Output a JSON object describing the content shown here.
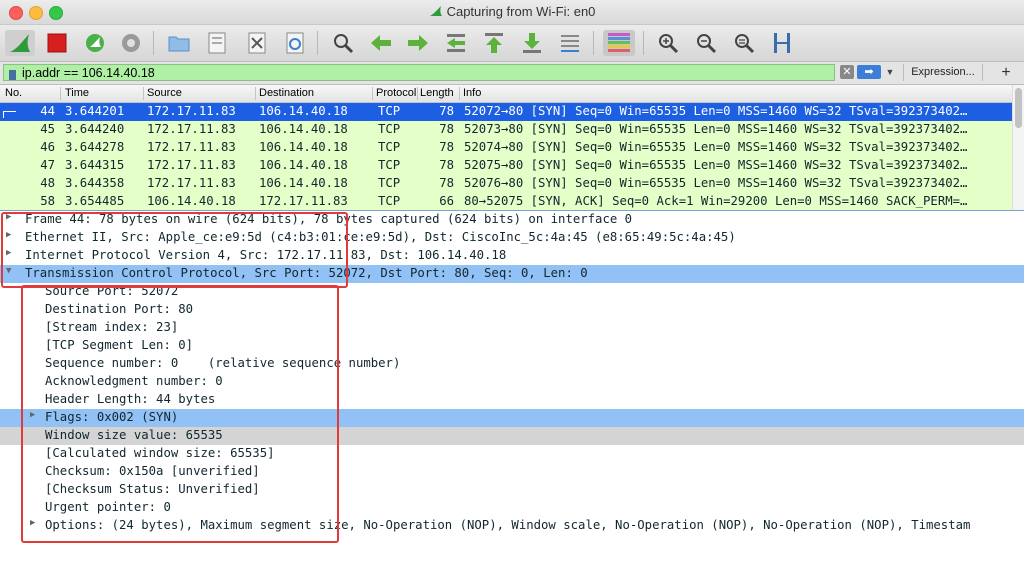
{
  "window": {
    "title": "Capturing from Wi-Fi: en0",
    "accent_green": "#2e9a3a",
    "selected_row_color": "#1c5fe3",
    "packet_row_color": "#e4ffc7",
    "highlight_color": "#92c1f5",
    "annotation_color": "#e03a3a"
  },
  "toolbar": {
    "buttons": [
      "shark-fin-icon",
      "stop-icon",
      "restart-icon",
      "options-gear-icon",
      "open-folder-icon",
      "save-file-icon",
      "close-file-icon",
      "reload-icon",
      "find-icon",
      "go-back-icon",
      "go-forward-icon",
      "go-to-packet-icon",
      "first-packet-icon",
      "last-packet-icon",
      "autoscroll-icon",
      "colorize-icon",
      "zoom-in-icon",
      "zoom-out-icon",
      "zoom-reset-icon",
      "resize-columns-icon"
    ]
  },
  "filter": {
    "value": "ip.addr == 106.14.40.18",
    "expression_label": "Expression...",
    "plus_label": "+"
  },
  "packet_list": {
    "columns": [
      "No.",
      "Time",
      "Source",
      "Destination",
      "Protocol",
      "Length",
      "Info"
    ],
    "rows": [
      {
        "no": "44",
        "time": "3.644201",
        "src": "172.17.11.83",
        "dst": "106.14.40.18",
        "proto": "TCP",
        "len": "78",
        "info": "52072→80 [SYN] Seq=0 Win=65535 Len=0 MSS=1460 WS=32 TSval=392373402…"
      },
      {
        "no": "45",
        "time": "3.644240",
        "src": "172.17.11.83",
        "dst": "106.14.40.18",
        "proto": "TCP",
        "len": "78",
        "info": "52073→80 [SYN] Seq=0 Win=65535 Len=0 MSS=1460 WS=32 TSval=392373402…"
      },
      {
        "no": "46",
        "time": "3.644278",
        "src": "172.17.11.83",
        "dst": "106.14.40.18",
        "proto": "TCP",
        "len": "78",
        "info": "52074→80 [SYN] Seq=0 Win=65535 Len=0 MSS=1460 WS=32 TSval=392373402…"
      },
      {
        "no": "47",
        "time": "3.644315",
        "src": "172.17.11.83",
        "dst": "106.14.40.18",
        "proto": "TCP",
        "len": "78",
        "info": "52075→80 [SYN] Seq=0 Win=65535 Len=0 MSS=1460 WS=32 TSval=392373402…"
      },
      {
        "no": "48",
        "time": "3.644358",
        "src": "172.17.11.83",
        "dst": "106.14.40.18",
        "proto": "TCP",
        "len": "78",
        "info": "52076→80 [SYN] Seq=0 Win=65535 Len=0 MSS=1460 WS=32 TSval=392373402…"
      },
      {
        "no": "58",
        "time": "3.654485",
        "src": "106.14.40.18",
        "dst": "172.17.11.83",
        "proto": "TCP",
        "len": "66",
        "info": "80→52075 [SYN, ACK] Seq=0 Ack=1 Win=29200 Len=0 MSS=1460 SACK_PERM=…"
      }
    ]
  },
  "details": {
    "frame": "Frame 44: 78 bytes on wire (624 bits), 78 bytes captured (624 bits) on interface 0",
    "ethernet": "Ethernet II, Src: Apple_ce:e9:5d (c4:b3:01:ce:e9:5d), Dst: CiscoInc_5c:4a:45 (e8:65:49:5c:4a:45)",
    "ip": "Internet Protocol Version 4, Src: 172.17.11.83, Dst: 106.14.40.18",
    "tcp": "Transmission Control Protocol, Src Port: 52072, Dst Port: 80, Seq: 0, Len: 0",
    "tcp_fields": [
      "Source Port: 52072",
      "Destination Port: 80",
      "[Stream index: 23]",
      "[TCP Segment Len: 0]",
      "Sequence number: 0    (relative sequence number)",
      "Acknowledgment number: 0",
      "Header Length: 44 bytes",
      "Flags: 0x002 (SYN)",
      "Window size value: 65535",
      "[Calculated window size: 65535]",
      "Checksum: 0x150a [unverified]",
      "[Checksum Status: Unverified]",
      "Urgent pointer: 0",
      "Options: (24 bytes), Maximum segment size, No-Operation (NOP), Window scale, No-Operation (NOP), No-Operation (NOP), Timestam"
    ]
  }
}
